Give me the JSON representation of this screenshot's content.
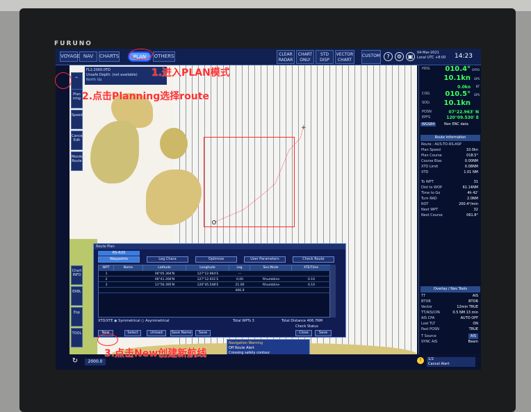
{
  "brand": "FURUNO",
  "toolbar": {
    "tabs": [
      "VOYAGE",
      "NAV",
      "CHARTS",
      "PLAN",
      "OTHERS"
    ],
    "active_tab": "PLAN",
    "buttons": [
      {
        "label": "CLEAR RADAR"
      },
      {
        "label": "CHART ONLY"
      },
      {
        "label": "STD DISP"
      },
      {
        "label": "VECTOR CHART"
      },
      {
        "label": "CUSTOM"
      }
    ],
    "help": "?",
    "date": "04-Mar-2021",
    "local": "Local UTC +8:00",
    "time": "14:23"
  },
  "left_buttons": [
    {
      "label": "Plan ning"
    },
    {
      "label": "Speed"
    },
    {
      "label": "Cancel Edit"
    },
    {
      "label": "Monitor Route"
    },
    {
      "label": "Chart INFO"
    },
    {
      "label": "ERBL"
    },
    {
      "label": "Esp"
    },
    {
      "label": "TOOL"
    }
  ],
  "chart_overlay": {
    "line1": "FL1:2000.0TD",
    "line2": "Unsafe Depth: (not available)",
    "line3": "North Up"
  },
  "readouts": {
    "hdg": {
      "label": "HDG",
      "value": "010.4°",
      "unit": "GYRO"
    },
    "spd_stw": {
      "label": "",
      "value": "10.1kn",
      "unit": "GPS"
    },
    "drift": {
      "label": "",
      "value": "0.0kn",
      "unit": "BT"
    },
    "cog": {
      "label": "COG",
      "value": "010.5°",
      "unit": "GPS"
    },
    "sog": {
      "label": "SOG",
      "value": "10.1kn",
      "unit": ""
    },
    "posn_lat": {
      "label": "POSN",
      "value": "07°22.963' N"
    },
    "posn_lon": {
      "label": "EPFS",
      "value": "120°09.530' E"
    },
    "datum": "WGS84",
    "enc_note": "Non ENC data"
  },
  "route_info": {
    "title": "Route information",
    "route": "Route : AUS-TO-RS-ASP",
    "plan_speed_label": "Plan Speed",
    "plan_speed": "10.0kn",
    "plan_course_label": "Plan Course",
    "plan_course": "018.5°",
    "xte_label": "Course Bias",
    "xte": "0.00NM",
    "xtd_label": "XTD Limit",
    "xtd": "0.08NM",
    "xtd2_label": "XTD",
    "xtd2": "1.01 NM",
    "to_wpt_label": "To WPT",
    "to_wpt": "31",
    "dist_label": "Dist to WOP",
    "dist": "61.14NM",
    "time_label": "Time to Go",
    "time_val": "4h 42'",
    "turn_label": "Turn RAD",
    "turn": "2.0NM",
    "rot_label": "ROT",
    "rot": "200.4°/min",
    "next_label": "Next WPT",
    "next": "32",
    "next_course_label": "Next Course",
    "next_course": "061.8°"
  },
  "overlay_panel": {
    "title": "Overlay / Nav Tools",
    "rows": [
      {
        "k": "TT",
        "v": "AIS"
      },
      {
        "k": "BTOR",
        "v": "BTOR"
      },
      {
        "k": "Vector",
        "v": "12min  TRUE"
      },
      {
        "k": "TT/AIS/CPA",
        "v": "0.5 NM  13 min"
      },
      {
        "k": "AIS CPA",
        "v": "AUTO OFF"
      },
      {
        "k": "Lost TLT",
        "v": "ON"
      },
      {
        "k": "Past POSN",
        "v": "TRUE"
      }
    ],
    "t_source": "T Source",
    "t_source_val": "AIS",
    "sync_label": "SYNC AIS",
    "beam_label": "Beam"
  },
  "route_plan": {
    "title": "Route Plan",
    "route_name": "RS-AUS",
    "tabs": [
      "Waypoints",
      "Leg Chara",
      "Optimize",
      "User Parameters",
      "Check Route"
    ],
    "selected_tab": "Waypoints",
    "columns": [
      "WPT",
      "Name",
      "Latitude",
      "Longitude",
      "Leg",
      "Sea Mode",
      "XTE/Time"
    ],
    "rows": [
      {
        "wpt": "1",
        "name": "",
        "lat": "06°05.364'N",
        "lon": "127°12.964'E",
        "leg": "---",
        "mode": "",
        "xte": ""
      },
      {
        "wpt": "2",
        "name": "",
        "lat": "06°41.266'N",
        "lon": "127°12.931'E",
        "leg": "0.00",
        "mode": "Rhumbline",
        "xte": "0.10"
      },
      {
        "wpt": "3",
        "name": "",
        "lat": "11°56.395'N",
        "lon": "120°45.548'E",
        "leg": "21.00",
        "mode": "Rhumbline",
        "xte": "0.10"
      },
      {
        "wpt": "",
        "name": "",
        "lat": "",
        "lon": "",
        "leg": "406.9",
        "mode": "",
        "xte": ""
      }
    ],
    "xtd_label": "XTD/XTE",
    "symmetrical": "Symmetrical",
    "asymmetrical": "Asymmetrical",
    "total_label": "Total WPTs",
    "total_val": "3",
    "total_dist_label": "Total Distance",
    "total_dist": "406.7NM",
    "check_status": "Check Status",
    "buttons": [
      "New",
      "Select",
      "Unload",
      "Save Name",
      "Save",
      "Close",
      "Save"
    ]
  },
  "alert": {
    "title": "Navigation Warning",
    "line1": "Off Route Alert",
    "line2": "Crossing safety contour"
  },
  "bottom": {
    "scale": "2000.0",
    "ack_count": "1/2",
    "alert_time": "Cancel Alert"
  },
  "annotations": {
    "step1": "1.进入PLAN模式",
    "step2": "2.点击Planning选择route",
    "step3": "3.点击New创建新航线"
  },
  "colors": {
    "accent_red": "#ff2a2a",
    "nav_green": "#3cff5a",
    "panel_blue": "#101c52",
    "land": "#d9c27a"
  }
}
